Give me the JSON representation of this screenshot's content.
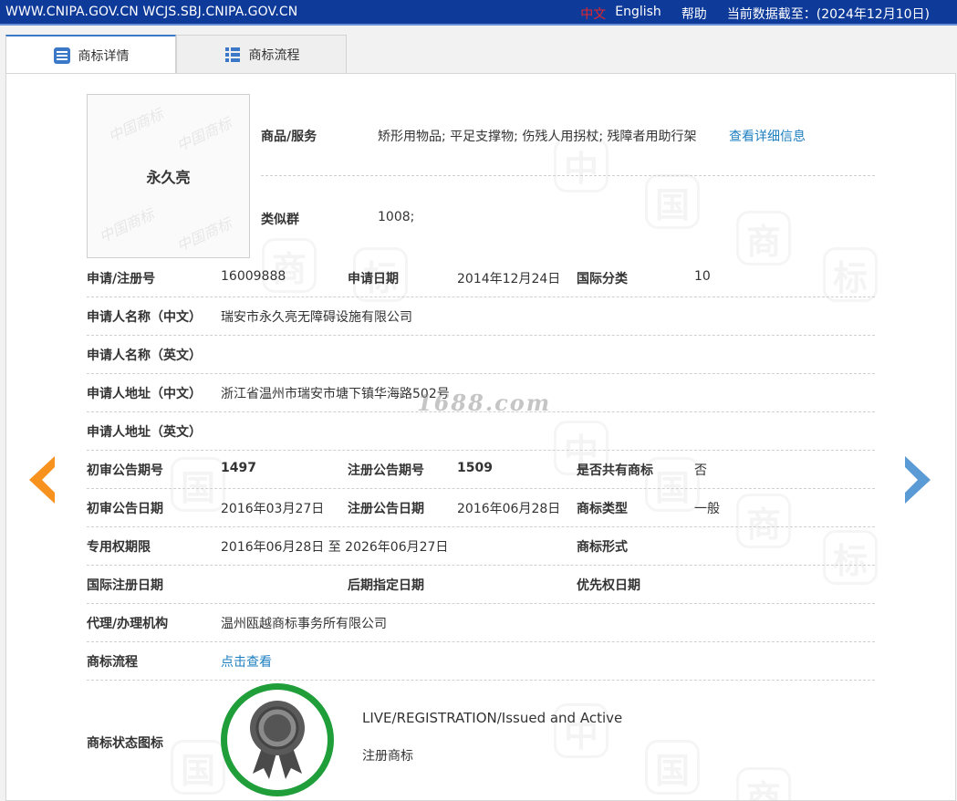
{
  "header": {
    "site": "WWW.CNIPA.GOV.CN WCJS.SBJ.CNIPA.GOV.CN",
    "lang_cn": "中文",
    "lang_en": "English",
    "help": "帮助",
    "data_date": "当前数据截至：(2024年12月10日)"
  },
  "tabs": [
    {
      "label": "商标详情",
      "icon": "list-detail-icon",
      "active": true
    },
    {
      "label": "商标流程",
      "icon": "list-grid-icon",
      "active": false
    }
  ],
  "trademark": {
    "name": "永久亮",
    "goods_label": "商品/服务",
    "goods_value": "矫形用物品; 平足支撑物; 伤残人用拐杖; 残障者用助行架",
    "goods_link": "查看详细信息",
    "similar_label": "类似群",
    "similar_value": "1008;",
    "reg_no_label": "申请/注册号",
    "reg_no": "16009888",
    "apply_date_label": "申请日期",
    "apply_date": "2014年12月24日",
    "intl_class_label": "国际分类",
    "intl_class": "10",
    "applicant_cn_label": "申请人名称（中文）",
    "applicant_cn": "瑞安市永久亮无障碍设施有限公司",
    "applicant_en_label": "申请人名称（英文）",
    "address_cn_label": "申请人地址（中文）",
    "address_cn": "浙江省温州市瑞安市塘下镇华海路502号",
    "address_en_label": "申请人地址（英文）",
    "prelim_no_label": "初审公告期号",
    "prelim_no": "1497",
    "reg_pub_no_label": "注册公告期号",
    "reg_pub_no": "1509",
    "shared_label": "是否共有商标",
    "shared": "否",
    "prelim_date_label": "初审公告日期",
    "prelim_date": "2016年03月27日",
    "reg_pub_date_label": "注册公告日期",
    "reg_pub_date": "2016年06月28日",
    "tm_type_label": "商标类型",
    "tm_type": "一般",
    "term_label": "专用权期限",
    "term": "2016年06月28日 至 2026年06月27日",
    "tm_form_label": "商标形式",
    "intl_reg_date_label": "国际注册日期",
    "later_designation_label": "后期指定日期",
    "priority_date_label": "优先权日期",
    "agent_label": "代理/办理机构",
    "agent": "温州瓯越商标事务所有限公司",
    "process_label": "商标流程",
    "process_link": "点击查看",
    "status_label": "商标状态图标",
    "status_en": "LIVE/REGISTRATION/Issued and Active",
    "status_cn": "注册商标"
  },
  "overlay_watermark": "1688.com",
  "colors": {
    "topbar": "#0e3a9a",
    "link": "#1e7fc0",
    "prev_arrow": "#f7921e",
    "next_arrow": "#5b9bd5",
    "badge_ring": "#1f9e3a"
  }
}
